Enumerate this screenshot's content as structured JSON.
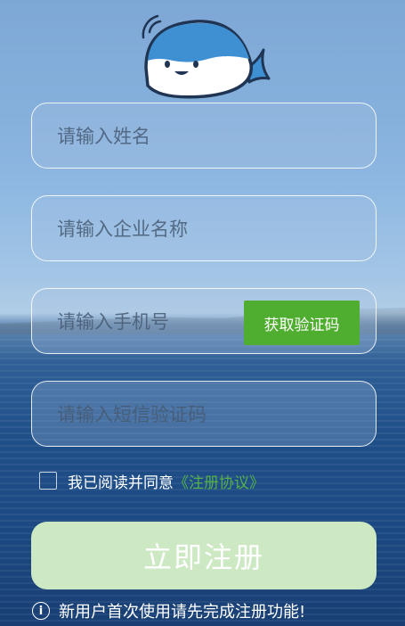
{
  "form": {
    "name_placeholder": "请输入姓名",
    "company_placeholder": "请输入企业名称",
    "phone_placeholder": "请输入手机号",
    "sms_placeholder": "请输入短信验证码",
    "get_code_label": "获取验证码"
  },
  "agreement": {
    "checked": false,
    "text": "我已阅读并同意",
    "link_label": "《注册协议》"
  },
  "register_label": "立即注册",
  "tip": {
    "icon": "info-icon",
    "text": "新用户首次使用请先完成注册功能!"
  },
  "colors": {
    "accent_green": "#4fae2f",
    "link_green": "#56b04a",
    "disabled_button": "#cde9c4"
  }
}
